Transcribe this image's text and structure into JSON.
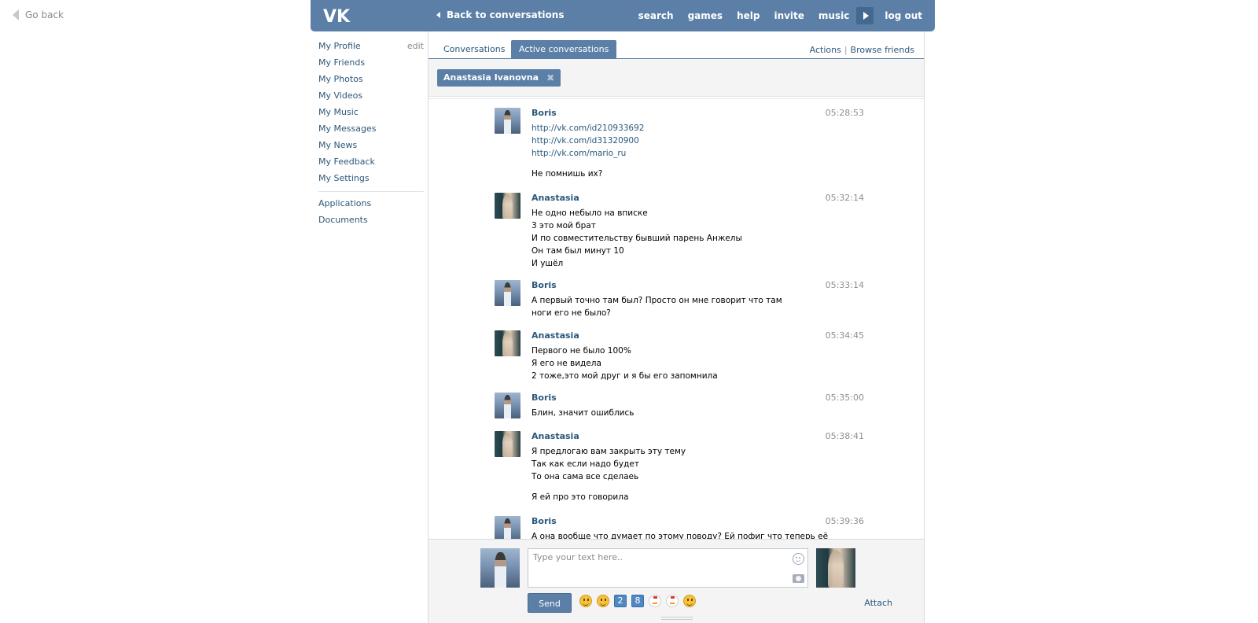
{
  "go_back": "Go back",
  "header": {
    "logo": "VK",
    "back_to_conversations": "Back to conversations",
    "nav": [
      "search",
      "games",
      "help",
      "invite",
      "music"
    ],
    "logout": "log out"
  },
  "sidebar": {
    "profile": "My Profile",
    "edit": "edit",
    "items": [
      "My Friends",
      "My Photos",
      "My Videos",
      "My Music",
      "My Messages",
      "My News",
      "My Feedback",
      "My Settings"
    ],
    "extra": [
      "Applications",
      "Documents"
    ]
  },
  "tabs": {
    "conversations": "Conversations",
    "active": "Active conversations",
    "actions": "Actions",
    "separator": "|",
    "browse": "Browse friends"
  },
  "peer_chip": {
    "name": "Anastasia Ivanovna",
    "close": "✖"
  },
  "messages": [
    {
      "author": "Boris",
      "time": "05:28:53",
      "lines": [
        "http://vk.com/id210933692",
        "http://vk.com/id31320900",
        "http://vk.com/mario_ru",
        "Не помнишь их?"
      ]
    },
    {
      "author": "Anastasia",
      "time": "05:32:14",
      "lines": [
        "Не одно небыло на вписке",
        "3 это мой брат",
        "И по совместительству бывший парень Анжелы",
        "Он там был минут  10",
        "И ушёл"
      ]
    },
    {
      "author": "Boris",
      "time": "05:33:14",
      "lines": [
        "А первый точно там был? Просто он мне говорит что там ноги его не было?"
      ]
    },
    {
      "author": "Anastasia",
      "time": "05:34:45",
      "lines": [
        "Первого не было 100%",
        "Я его не видела",
        "2 тоже,это мой друг и я бы его запомнила"
      ]
    },
    {
      "author": "Boris",
      "time": "05:35:00",
      "lines": [
        "Блин, значит ошиблись"
      ]
    },
    {
      "author": "Anastasia",
      "time": "05:38:41",
      "lines": [
        "Я предлогаю вам закрыть эту тему",
        "Так как если надо будет",
        "То она сама все сделаеь",
        "Я ей про это говорила"
      ]
    },
    {
      "author": "Boris",
      "time": "05:39:36",
      "lines": [
        "А она вообще что думает по этому поводу? Ей пофиг что теперь её"
      ]
    }
  ],
  "composer": {
    "placeholder": "Type your text here..",
    "send": "Send",
    "attach": "Attach",
    "emoji_digits": [
      "2",
      "8"
    ]
  }
}
